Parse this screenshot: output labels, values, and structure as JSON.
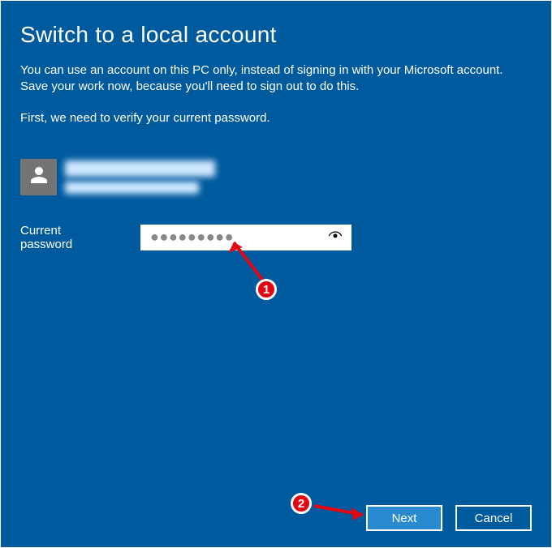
{
  "header": {
    "title": "Switch to a local account",
    "description": "You can use an account on this PC only, instead of signing in with your Microsoft account. Save your work now, because you'll need to sign out to do this.",
    "verify": "First, we need to verify your current password."
  },
  "user": {
    "display_name_obscured": true,
    "email_obscured": true
  },
  "form": {
    "password_label": "Current password",
    "password_value": "",
    "password_mask": "●●●●●●●●●"
  },
  "buttons": {
    "next": "Next",
    "cancel": "Cancel"
  },
  "annotations": {
    "step1": "1",
    "step2": "2"
  }
}
